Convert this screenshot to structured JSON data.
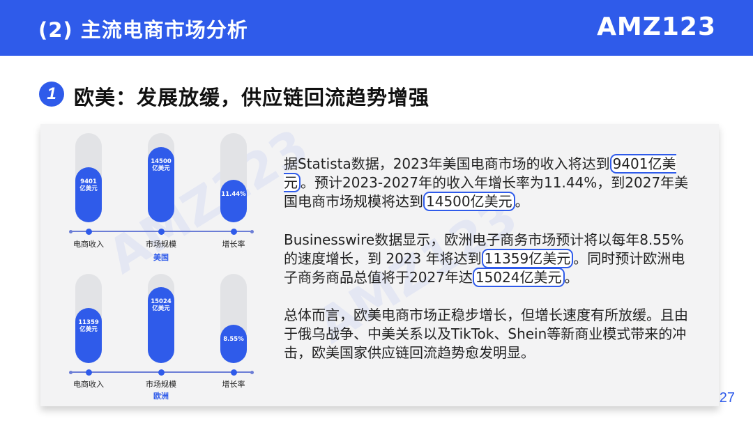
{
  "header": {
    "title": "(2) 主流电商市场分析",
    "brand": "AMZ123"
  },
  "section": {
    "number": "1",
    "title": "欧美：发展放缓，供应链回流趋势增强"
  },
  "watermark": "AMZ123",
  "chart_data": [
    {
      "type": "bar",
      "title": "",
      "group_label": "美国",
      "categories": [
        "电商收入",
        "市场规模",
        "增长率"
      ],
      "value_labels": [
        "9401\n亿美元",
        "14500\n亿美元",
        "11.44%"
      ],
      "values": [
        9401,
        14500,
        11.44
      ],
      "fill_fraction": [
        0.62,
        0.84,
        0.48
      ]
    },
    {
      "type": "bar",
      "title": "",
      "group_label": "欧洲",
      "categories": [
        "电商收入",
        "市场规模",
        "增长率"
      ],
      "value_labels": [
        "11359\n亿美元",
        "15024\n亿美元",
        "8.55%"
      ],
      "values": [
        11359,
        15024,
        8.55
      ],
      "fill_fraction": [
        0.62,
        0.85,
        0.43
      ]
    }
  ],
  "paragraphs": [
    {
      "parts": [
        {
          "text": "据Statista数据，2023年美国电商市场的收入将达到",
          "hl": false
        },
        {
          "text": "9401亿美元",
          "hl": true
        },
        {
          "text": "。预计2023-2027年的收入年增长率为11.44%，到2027年美国电商市场规模将达到",
          "hl": false
        },
        {
          "text": "14500亿美元",
          "hl": true
        },
        {
          "text": "。",
          "hl": false
        }
      ]
    },
    {
      "parts": [
        {
          "text": "Businesswire数据显示，欧洲电子商务市场预计将以每年8.55%的速度增长，到 2023 年将达到",
          "hl": false
        },
        {
          "text": "11359亿美元",
          "hl": true
        },
        {
          "text": "。同时预计欧洲电子商务商品总值将于2027年达",
          "hl": false
        },
        {
          "text": "15024亿美元",
          "hl": true
        },
        {
          "text": "。",
          "hl": false
        }
      ]
    },
    {
      "parts": [
        {
          "text": "总体而言，欧美电商市场正稳步增长，但增长速度有所放缓。且由于俄乌战争、中美关系以及TikTok、Shein等新商业模式带来的冲击，欧美国家供应链回流趋势愈发明显。",
          "hl": false
        }
      ]
    }
  ],
  "page_number": "27",
  "colors": {
    "accent": "#2f5bea",
    "track": "#e2e3e6",
    "panel": "#f3f3f4"
  }
}
